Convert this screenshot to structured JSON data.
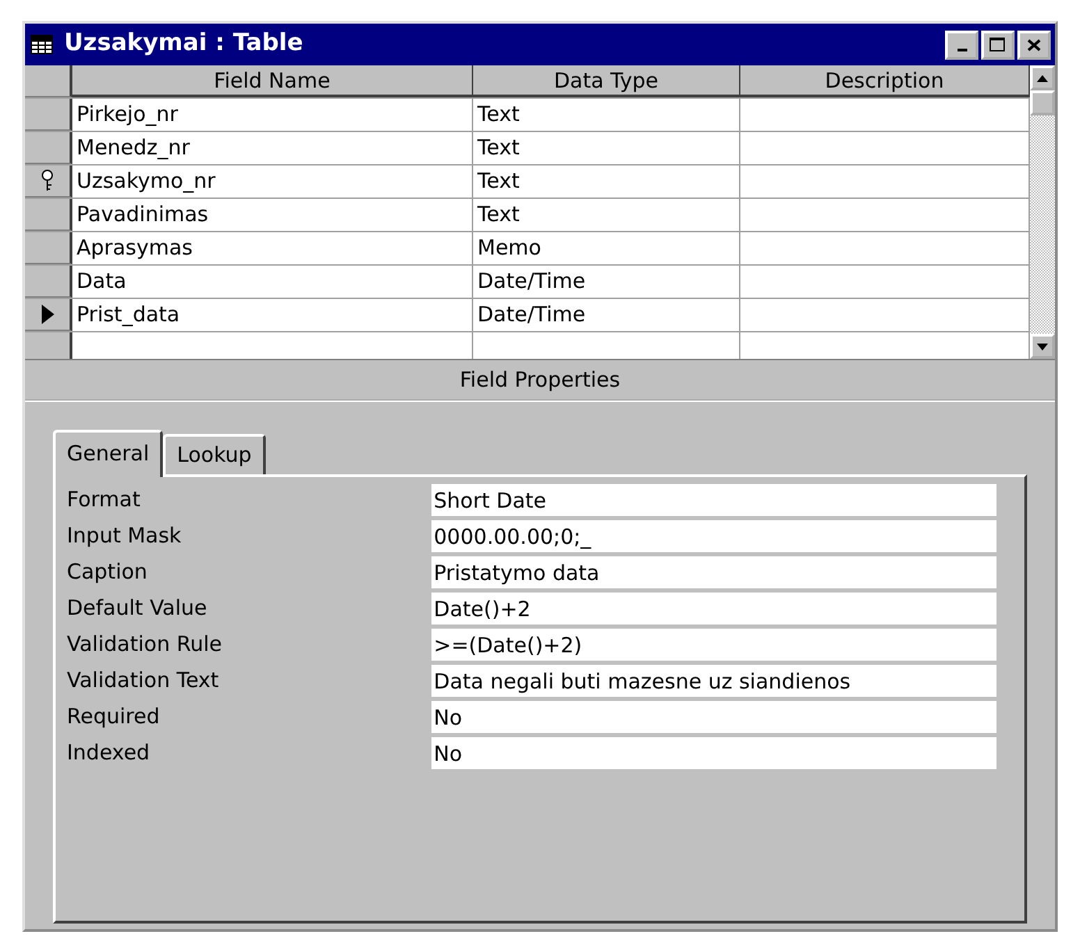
{
  "window": {
    "title": "Uzsakymai : Table"
  },
  "table": {
    "columns": [
      "Field Name",
      "Data Type",
      "Description"
    ],
    "rows": [
      {
        "field_name": "Pirkejo_nr",
        "data_type": "Text",
        "primary_key": false,
        "current": false
      },
      {
        "field_name": "Menedz_nr",
        "data_type": "Text",
        "primary_key": false,
        "current": false
      },
      {
        "field_name": "Uzsakymo_nr",
        "data_type": "Text",
        "primary_key": true,
        "current": false
      },
      {
        "field_name": "Pavadinimas",
        "data_type": "Text",
        "primary_key": false,
        "current": false
      },
      {
        "field_name": "Aprasymas",
        "data_type": "Memo",
        "primary_key": false,
        "current": false
      },
      {
        "field_name": "Data",
        "data_type": "Date/Time",
        "primary_key": false,
        "current": false
      },
      {
        "field_name": "Prist_data",
        "data_type": "Date/Time",
        "primary_key": false,
        "current": true
      }
    ]
  },
  "field_properties": {
    "title": "Field Properties",
    "tabs": [
      {
        "label": "General",
        "selected": true
      },
      {
        "label": "Lookup",
        "selected": false
      }
    ],
    "properties": [
      {
        "label": "Format",
        "value": "Short Date"
      },
      {
        "label": "Input Mask",
        "value": "0000.00.00;0;_"
      },
      {
        "label": "Caption",
        "value": "Pristatymo data"
      },
      {
        "label": "Default Value",
        "value": "Date()+2"
      },
      {
        "label": "Validation Rule",
        "value": ">=(Date()+2)"
      },
      {
        "label": "Validation Text",
        "value": "Data negali buti mazesne uz siandienos"
      },
      {
        "label": "Required",
        "value": "No"
      },
      {
        "label": "Indexed",
        "value": "No"
      }
    ]
  }
}
